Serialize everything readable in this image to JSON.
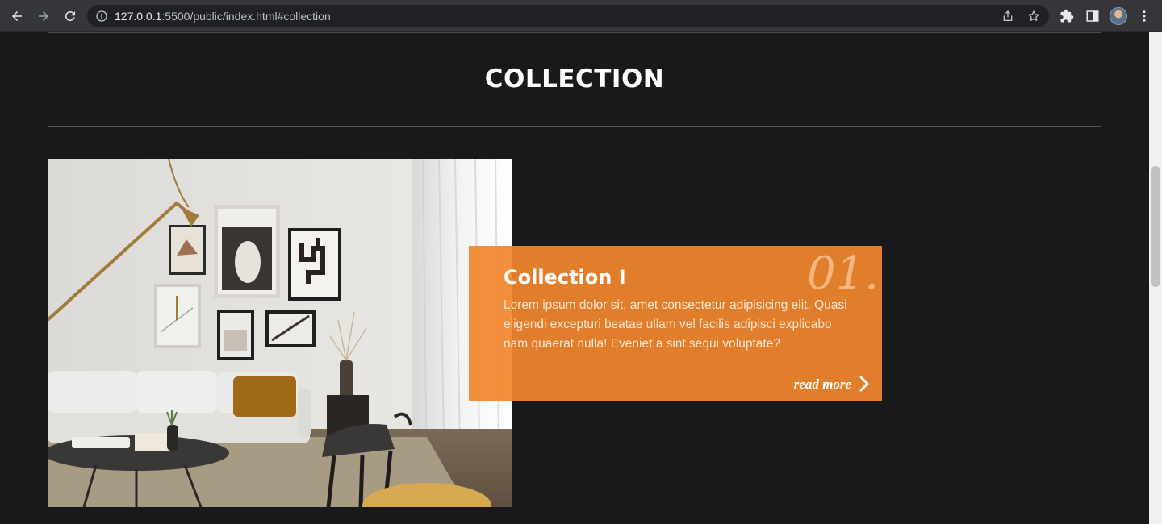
{
  "browser": {
    "url_host": "127.0.0.1",
    "url_rest": ":5500/public/index.html#collection",
    "icons": [
      "back-arrow-icon",
      "forward-arrow-icon",
      "reload-icon",
      "info-icon",
      "share-icon",
      "star-icon",
      "extensions-icon",
      "side-panel-icon",
      "profile-avatar",
      "kebab-menu-icon"
    ]
  },
  "section": {
    "title": "COLLECTION"
  },
  "collection_card": {
    "number": "01.",
    "title": "Collection I",
    "description": "Lorem ipsum dolor sit, amet consectetur adipisicing elit. Quasi eligendi excepturi beatae ullam vel facilis adipisci explicabo nam quaerat nulla! Eveniet a sint sequi voluptate?",
    "read_more": "read more",
    "accent_color": "#f0862d"
  },
  "colors": {
    "background": "#19191b",
    "chrome": "#35363a"
  }
}
